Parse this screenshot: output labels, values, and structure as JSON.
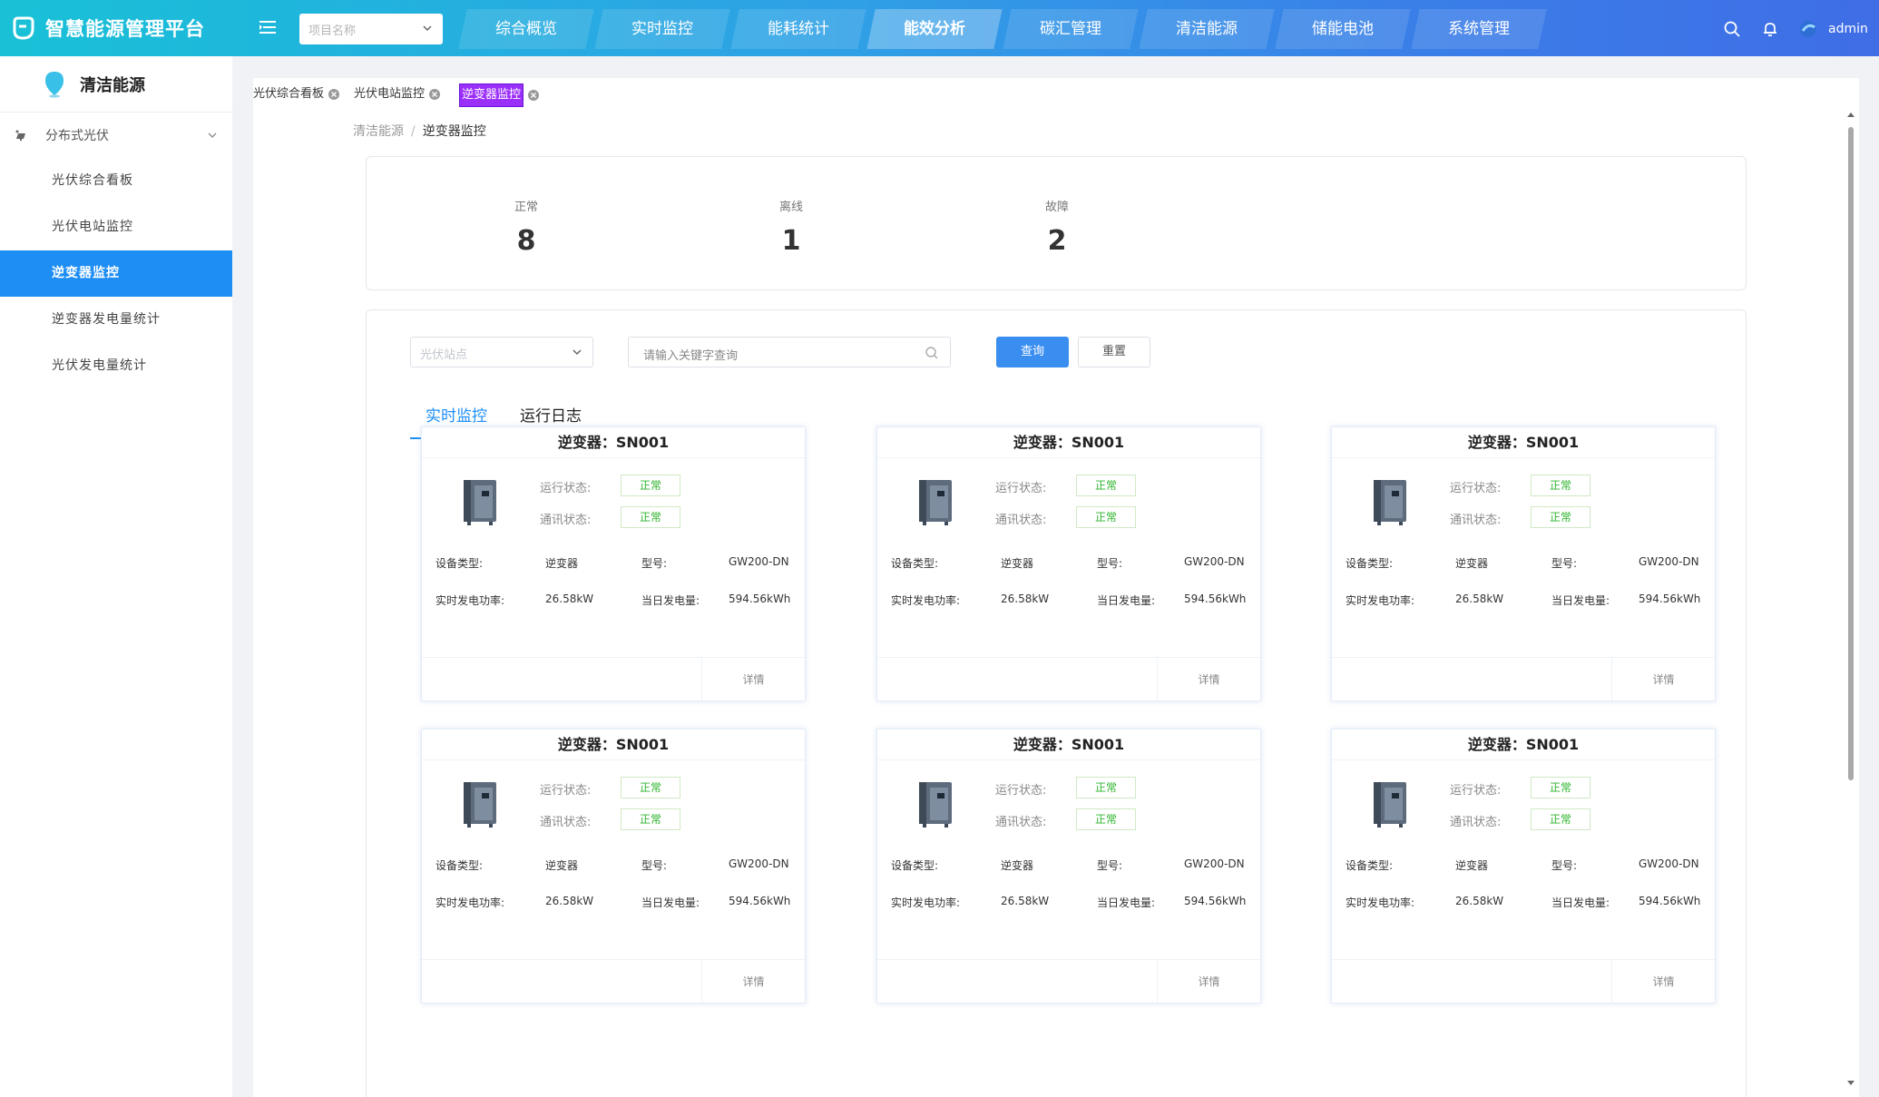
{
  "app": {
    "title": "智慧能源管理平台",
    "brand_color": "#1e8ef5"
  },
  "header": {
    "project_placeholder": "项目名称",
    "nav": [
      {
        "label": "综合概览",
        "active": false
      },
      {
        "label": "实时监控",
        "active": false
      },
      {
        "label": "能耗统计",
        "active": false
      },
      {
        "label": "能效分析",
        "active": true
      },
      {
        "label": "碳汇管理",
        "active": false
      },
      {
        "label": "清洁能源",
        "active": false
      },
      {
        "label": "储能电池",
        "active": false
      },
      {
        "label": "系统管理",
        "active": false
      }
    ],
    "user": "admin",
    "icons": [
      "search-icon",
      "bell-icon",
      "avatar"
    ]
  },
  "sidebar": {
    "title": "清洁能源",
    "group": "分布式光伏",
    "items": [
      {
        "label": "光伏综合看板",
        "active": false
      },
      {
        "label": "光伏电站监控",
        "active": false
      },
      {
        "label": "逆变器监控",
        "active": true
      },
      {
        "label": "逆变器发电量统计",
        "active": false
      },
      {
        "label": "光伏发电量统计",
        "active": false
      }
    ]
  },
  "page_tabs": [
    {
      "label": "光伏综合看板",
      "active": false
    },
    {
      "label": "光伏电站监控",
      "active": false
    },
    {
      "label": "逆变器监控",
      "active": true
    }
  ],
  "breadcrumb": {
    "parent": "清洁能源",
    "separator": "/",
    "current": "逆变器监控"
  },
  "stats": [
    {
      "label": "正常",
      "value": "8"
    },
    {
      "label": "离线",
      "value": "1"
    },
    {
      "label": "故障",
      "value": "2"
    }
  ],
  "filters": {
    "station_placeholder": "光伏站点",
    "search_placeholder": "请输入关键字查询",
    "query_label": "查询",
    "reset_label": "重置"
  },
  "sub_tabs": [
    {
      "label": "实时监控",
      "active": true
    },
    {
      "label": "运行日志",
      "active": false
    }
  ],
  "inverter_card_labels": {
    "run_status": "运行状态:",
    "comm_status": "通讯状态:",
    "device_type": "设备类型:",
    "model": "型号:",
    "realtime_power": "实时发电功率:",
    "daily_energy": "当日发电量:",
    "detail": "详情"
  },
  "inverters": [
    {
      "title": "逆变器：SN001",
      "run_status": "正常",
      "comm_status": "正常",
      "device_type": "逆变器",
      "model": "GW200-DN",
      "power": "26.58kW",
      "energy": "594.56kWh"
    },
    {
      "title": "逆变器：SN001",
      "run_status": "正常",
      "comm_status": "正常",
      "device_type": "逆变器",
      "model": "GW200-DN",
      "power": "26.58kW",
      "energy": "594.56kWh"
    },
    {
      "title": "逆变器：SN001",
      "run_status": "正常",
      "comm_status": "正常",
      "device_type": "逆变器",
      "model": "GW200-DN",
      "power": "26.58kW",
      "energy": "594.56kWh"
    },
    {
      "title": "逆变器：SN001",
      "run_status": "正常",
      "comm_status": "正常",
      "device_type": "逆变器",
      "model": "GW200-DN",
      "power": "26.58kW",
      "energy": "594.56kWh"
    },
    {
      "title": "逆变器：SN001",
      "run_status": "正常",
      "comm_status": "正常",
      "device_type": "逆变器",
      "model": "GW200-DN",
      "power": "26.58kW",
      "energy": "594.56kWh"
    },
    {
      "title": "逆变器：SN001",
      "run_status": "正常",
      "comm_status": "正常",
      "device_type": "逆变器",
      "model": "GW200-DN",
      "power": "26.58kW",
      "energy": "594.56kWh"
    }
  ],
  "colors": {
    "status_ok": "#2db52d",
    "active_tab": "#9b2ffa",
    "query_button": "#3a8ef0"
  }
}
